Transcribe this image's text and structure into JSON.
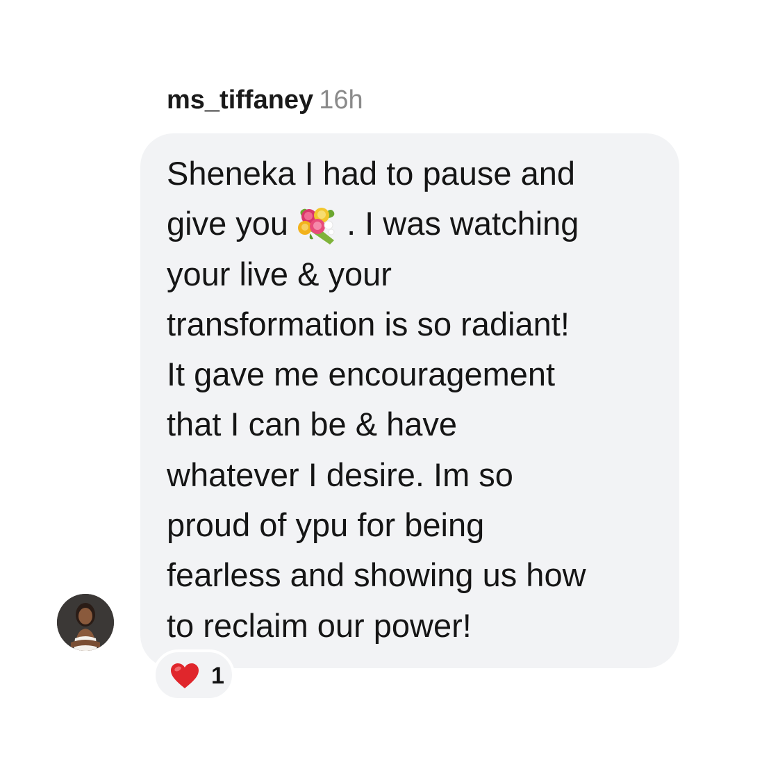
{
  "comment": {
    "username": "ms_tiffaney",
    "timestamp": "16h",
    "text_before_emoji": "Sheneka I had to pause and\ngive you",
    "emoji": "bouquet-icon",
    "text_after_emoji": ". I was watching\nyour live & your\ntransformation is so radiant!\nIt gave me encouragement\nthat I can be & have\nwhatever I desire. Im so\nproud of ypu for being\nfearless and showing us how\nto reclaim our power!"
  },
  "reaction": {
    "icon": "heart-icon",
    "count": "1"
  },
  "avatar": {
    "icon": "avatar"
  },
  "colors": {
    "bubble_background": "#f2f3f5",
    "timestamp": "#8a8a8a",
    "heart": "#e0262c"
  }
}
